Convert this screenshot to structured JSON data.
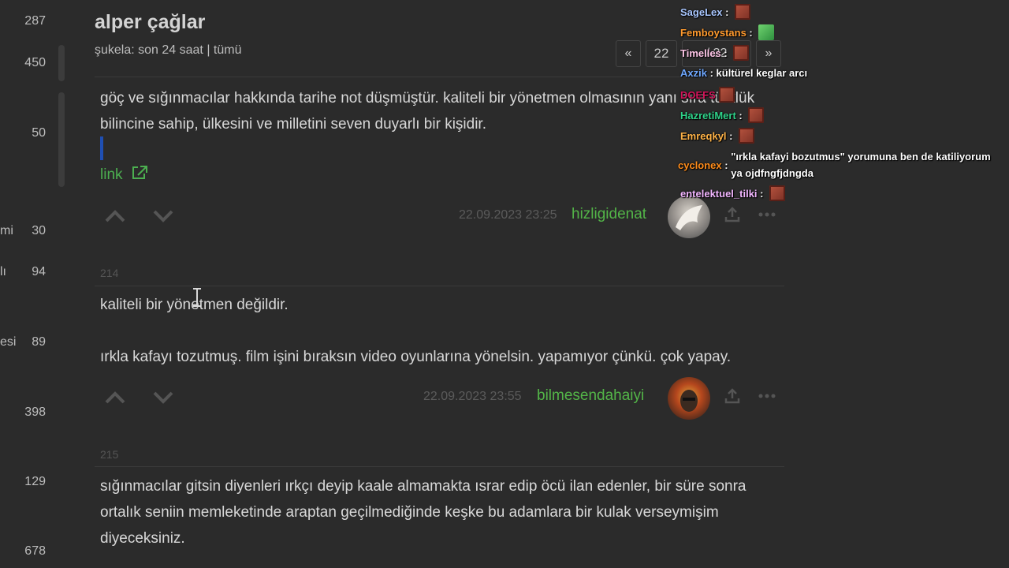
{
  "sidebar": {
    "items": [
      {
        "frag": "",
        "count": "287"
      },
      {
        "frag": "",
        "count": "450"
      },
      {
        "frag": "",
        "count": "50"
      },
      {
        "frag": "mi",
        "count": "30"
      },
      {
        "frag": "lı",
        "count": "94"
      },
      {
        "frag": "esi",
        "count": "89"
      },
      {
        "frag": "",
        "count": "398"
      },
      {
        "frag": "",
        "count": "129"
      },
      {
        "frag": "",
        "count": "678"
      }
    ]
  },
  "topic": {
    "title": "alper çağlar",
    "filter": "şukela: son 24 saat | tümü"
  },
  "pager": {
    "prev": "«",
    "current": "22",
    "total": "/ 22",
    "next": "»"
  },
  "entries": [
    {
      "text": "göç ve sığınmacılar hakkında tarihe not düşmüştür. kaliteli bir yönetmen olmasının yanı sıra türklük bilincine sahip, ülkesini ve milletini seven duyarlı bir kişidir.",
      "link": "link",
      "date": "22.09.2023 23:25",
      "author": "hizligidenat"
    },
    {
      "number": "214",
      "line1": "kaliteli bir yönetmen değildir.",
      "line2": "ırkla kafayı tozutmuş. film işini bıraksın video oyunlarına yönelsin. yapamıyor çünkü. çok yapay.",
      "date": "22.09.2023 23:55",
      "author": "bilmesendahaiyi"
    },
    {
      "number": "215",
      "text": "sığınmacılar gitsin diyenleri ırkçı deyip kaale almamakta ısrar edip öcü ilan edenler, bir süre sonra ortalık seniin memleketinde araptan geçilmediğinde keşke bu adamlara bir kulak verseymişim diyeceksiniz."
    }
  ],
  "chat": [
    {
      "user": "SageLex",
      "color": "#a9c7ff",
      "msg": "",
      "emote": "face"
    },
    {
      "user": "Femboystans",
      "color": "#ff9a2e",
      "msg": "",
      "emote": "green"
    },
    {
      "user": "Timelles",
      "color": "#ffc6e8",
      "msg": "",
      "emote": "face"
    },
    {
      "user": "Axzik",
      "color": "#6fa8ff",
      "msg": "kültürel keglar arcı",
      "emote": ""
    },
    {
      "user": "DOEFS",
      "color": "#d4145a",
      "msg": "",
      "emote": "face"
    },
    {
      "user": "HazretiMert",
      "color": "#2fd38a",
      "msg": "",
      "emote": "face"
    },
    {
      "user": "Emreqkyl",
      "color": "#ffb347",
      "msg": "",
      "emote": "face"
    },
    {
      "user": "cyclonex",
      "color": "#ff8c1a",
      "msg": "\"ırkla kafayi bozutmus\" yorumuna ben de katiliyorum ya ojdfngfjdngda",
      "emote": ""
    },
    {
      "user": "entelektuel_tilki",
      "color": "#f2b6ff",
      "msg": "",
      "emote": "face"
    }
  ],
  "icons": [
    "upvote-icon",
    "downvote-icon",
    "external-link-icon",
    "share-icon",
    "more-icon"
  ],
  "colors": {
    "background": "#2b2b2b",
    "author": "#53b548",
    "link": "#4caf50",
    "meta": "#5b5b5b"
  }
}
